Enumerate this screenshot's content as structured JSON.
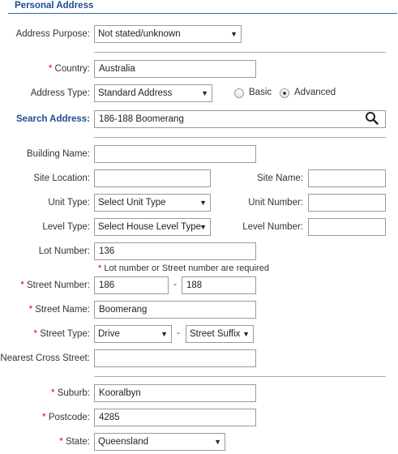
{
  "section_title": "Personal Address",
  "address_purpose": {
    "label": "Address Purpose:",
    "value": "Not stated/unknown"
  },
  "country": {
    "label": "Country:",
    "value": "Australia"
  },
  "address_type": {
    "label": "Address Type:",
    "value": "Standard Address",
    "mode_options": [
      "Basic",
      "Advanced"
    ],
    "selected_mode": "Advanced"
  },
  "search_address": {
    "label": "Search Address:",
    "value": "186-188 Boomerang",
    "icon": "search-icon"
  },
  "building_name": {
    "label": "Building Name:",
    "value": ""
  },
  "site_location": {
    "label": "Site Location:",
    "value": ""
  },
  "site_name": {
    "label": "Site Name:",
    "value": ""
  },
  "unit_type": {
    "label": "Unit Type:",
    "value": "Select Unit Type"
  },
  "unit_number": {
    "label": "Unit Number:",
    "value": ""
  },
  "level_type": {
    "label": "Level Type:",
    "value": "Select House Level Type"
  },
  "level_number": {
    "label": "Level Number:",
    "value": ""
  },
  "lot_number": {
    "label": "Lot Number:",
    "value": "136"
  },
  "lot_note": "Lot number or Street number are required",
  "street_number": {
    "label": "Street Number:",
    "from": "186",
    "to": "188",
    "separator": "-"
  },
  "street_name": {
    "label": "Street Name:",
    "value": "Boomerang"
  },
  "street_type": {
    "label": "Street Type:",
    "value": "Drive",
    "separator": "-",
    "suffix": "Street Suffix"
  },
  "nearest_cross_street": {
    "label": "Nearest Cross Street:",
    "value": ""
  },
  "suburb": {
    "label": "Suburb:",
    "value": "Kooralbyn"
  },
  "postcode": {
    "label": "Postcode:",
    "value": "4285"
  },
  "state": {
    "label": "State:",
    "value": "Queensland"
  },
  "required_marker": "*",
  "colors": {
    "title": "#1f4e8c",
    "required": "#d00000",
    "rule": "#2e6da4"
  }
}
